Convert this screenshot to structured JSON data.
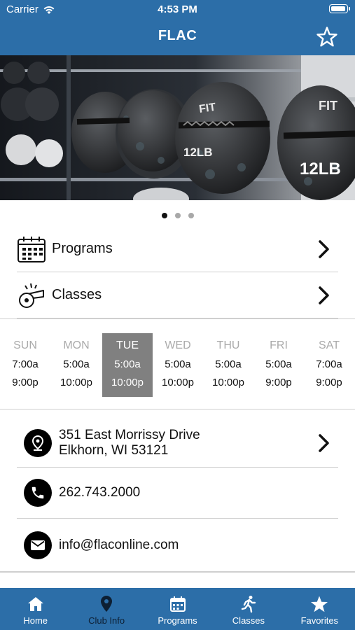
{
  "status_bar": {
    "carrier": "Carrier",
    "time": "4:53 PM"
  },
  "nav": {
    "title": "FLAC",
    "favorite_icon": "star-outline-icon"
  },
  "hero": {
    "carousel_pages": 3,
    "active_page": 1,
    "image_desc_text": [
      "FIT",
      "12LB",
      "FIT",
      "12LB"
    ]
  },
  "menu": [
    {
      "label": "Programs",
      "icon": "calendar-icon"
    },
    {
      "label": "Classes",
      "icon": "whistle-icon"
    }
  ],
  "hours": {
    "days": [
      {
        "day": "SUN",
        "open": "7:00a",
        "close": "9:00p"
      },
      {
        "day": "MON",
        "open": "5:00a",
        "close": "10:00p"
      },
      {
        "day": "TUE",
        "open": "5:00a",
        "close": "10:00p"
      },
      {
        "day": "WED",
        "open": "5:00a",
        "close": "10:00p"
      },
      {
        "day": "THU",
        "open": "5:00a",
        "close": "10:00p"
      },
      {
        "day": "FRI",
        "open": "5:00a",
        "close": "9:00p"
      },
      {
        "day": "SAT",
        "open": "7:00a",
        "close": "9:00p"
      }
    ],
    "selected_day": "TUE"
  },
  "contact": {
    "address_line1": "351 East Morrissy Drive",
    "address_line2": "Elkhorn, WI 53121",
    "phone": "262.743.2000",
    "email": "info@flaconline.com"
  },
  "tabs": [
    {
      "label": "Home",
      "icon": "home-icon"
    },
    {
      "label": "Club Info",
      "icon": "location-pin-icon"
    },
    {
      "label": "Programs",
      "icon": "calendar-icon"
    },
    {
      "label": "Classes",
      "icon": "running-person-icon"
    },
    {
      "label": "Favorites",
      "icon": "star-icon"
    }
  ],
  "active_tab": "Club Info",
  "colors": {
    "brand": "#2c6ea8",
    "selected_day": "#808080",
    "active_tab_text": "#0d1f33"
  }
}
